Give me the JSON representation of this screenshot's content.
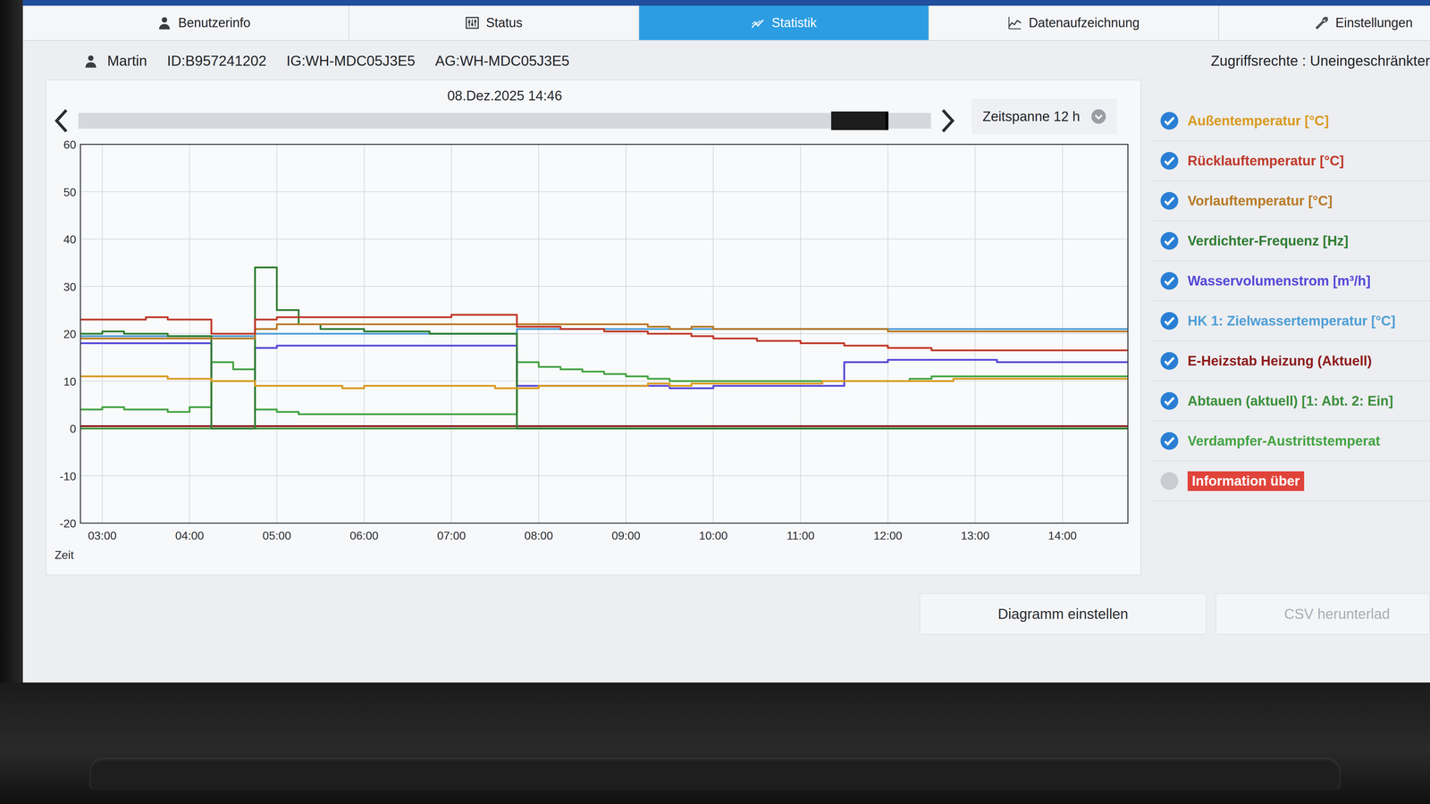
{
  "tabs": [
    {
      "label": "Benutzerinfo",
      "selected": false
    },
    {
      "label": "Status",
      "selected": false
    },
    {
      "label": "Statistik",
      "selected": true
    },
    {
      "label": "Datenaufzeichnung",
      "selected": false
    },
    {
      "label": "Einstellungen",
      "selected": false
    }
  ],
  "user": {
    "name": "Martin",
    "id": "ID:B957241202",
    "ig": "IG:WH-MDC05J3E5",
    "ag": "AG:WH-MDC05J3E5",
    "access": "Zugriffsrechte : Uneingeschränkter"
  },
  "chart": {
    "date": "08.Dez.2025 14:46",
    "timeline_level": 0.95,
    "span": "Zeitspanne 12 h",
    "x_label": "Zeit",
    "y_ticks": [
      "60",
      "50",
      "40",
      "30",
      "20",
      "10",
      "0",
      "-10",
      "-20"
    ],
    "x_ticks": [
      "03:00",
      "04:00",
      "05:00",
      "06:00",
      "07:00",
      "08:00",
      "09:00",
      "10:00",
      "11:00",
      "12:00",
      "13:00",
      "14:00"
    ],
    "y_min": -20,
    "y_max": 60,
    "x_min": 2.75,
    "x_max": 14.75,
    "x_start": 2.75,
    "x_step": 0.25,
    "series": [
      {
        "label": "Außentemperatur [°C]",
        "kind": "series",
        "checked": true,
        "color": "#d99a1e",
        "values": [
          11,
          11,
          11,
          11,
          10.5,
          10.5,
          10,
          10,
          9,
          9,
          9,
          9,
          8.5,
          9,
          9,
          9,
          9,
          9,
          9,
          8.5,
          8.5,
          9,
          9,
          9,
          9,
          9,
          9.5,
          9,
          9.5,
          9.5,
          9.5,
          9.5,
          9.5,
          9.5,
          10,
          10,
          10,
          10,
          10,
          10,
          10.5,
          10.5,
          10.5,
          10.5,
          10.5,
          10.5,
          10.5,
          10.5,
          10.5
        ]
      },
      {
        "label": "Rücklauftemperatur [°C]",
        "kind": "series",
        "checked": true,
        "color": "#c0392b",
        "values": [
          23,
          23,
          23,
          23.5,
          23,
          23,
          20,
          20,
          23,
          23.5,
          23.5,
          23.5,
          23.5,
          23.5,
          23.5,
          23.5,
          23.5,
          24,
          24,
          24,
          21.5,
          21.5,
          21,
          21,
          20.5,
          20.5,
          20,
          20,
          19.5,
          19,
          19,
          18.5,
          18.5,
          18,
          18,
          17.5,
          17.5,
          17,
          17,
          16.5,
          16.5,
          16.5,
          16.5,
          16.5,
          16.5,
          16.5,
          16.5,
          16.5,
          16.5
        ]
      },
      {
        "label": "Vorlauftemperatur [°C]",
        "kind": "series",
        "checked": true,
        "color": "#b87a26",
        "values": [
          19,
          19,
          19,
          19,
          19,
          19,
          19,
          19,
          21,
          22,
          22,
          22,
          22,
          22,
          22,
          22,
          22,
          22,
          22,
          22,
          22,
          22,
          22,
          22,
          22,
          22,
          21.5,
          21,
          21.5,
          21,
          21,
          21,
          21,
          21,
          21,
          21,
          21,
          20.5,
          20.5,
          20.5,
          20.5,
          20.5,
          20.5,
          20.5,
          20.5,
          20.5,
          20.5,
          20.5,
          20.5
        ]
      },
      {
        "label": "Verdichter-Frequenz [Hz]",
        "kind": "series",
        "checked": true,
        "color": "#2f7d32",
        "values": [
          20,
          20.5,
          20,
          20,
          19.5,
          19.5,
          0,
          0,
          34,
          25,
          22,
          21,
          21,
          20.5,
          20.5,
          20.5,
          20,
          20,
          20,
          20,
          0,
          0,
          0,
          0,
          0,
          0,
          0,
          0,
          0,
          0,
          0,
          0,
          0,
          0,
          0,
          0,
          0,
          0,
          0,
          0,
          0,
          0,
          0,
          0,
          0,
          0,
          0,
          0,
          0
        ]
      },
      {
        "label": "Wasservolumenstrom [m³/h]",
        "kind": "series",
        "checked": true,
        "color": "#5548d9",
        "values": [
          18,
          18,
          18,
          18,
          18,
          18,
          10,
          10,
          17,
          17.5,
          17.5,
          17.5,
          17.5,
          17.5,
          17.5,
          17.5,
          17.5,
          17.5,
          17.5,
          17.5,
          9,
          9,
          9,
          9,
          9,
          9,
          9,
          8.5,
          8.5,
          9,
          9,
          9,
          9,
          9,
          9,
          14,
          14,
          14.5,
          14.5,
          14.5,
          14.5,
          14.5,
          14,
          14,
          14,
          14,
          14,
          14,
          14
        ]
      },
      {
        "label": "HK 1: Zielwassertemperatur [°C]",
        "kind": "series",
        "checked": true,
        "color": "#4f9fd6",
        "values": [
          19.5,
          19.5,
          19.5,
          19.5,
          19.5,
          19.5,
          19.5,
          19.5,
          20,
          20,
          20,
          20,
          20,
          20,
          20,
          20,
          20,
          20,
          20,
          20,
          21,
          21,
          21,
          21,
          21,
          21,
          21,
          21,
          21,
          21,
          21,
          21,
          21,
          21,
          21,
          21,
          21,
          21,
          21,
          21,
          21,
          21,
          21,
          21,
          21,
          21,
          21,
          21,
          21
        ]
      },
      {
        "label": "E-Heizstab Heizung (Aktuell)",
        "kind": "series",
        "checked": true,
        "color": "#8e1c1c",
        "values": [
          0.5,
          0.5,
          0.5,
          0.5,
          0.5,
          0.5,
          0.5,
          0.5,
          0.5,
          0.5,
          0.5,
          0.5,
          0.5,
          0.5,
          0.5,
          0.5,
          0.5,
          0.5,
          0.5,
          0.5,
          0.5,
          0.5,
          0.5,
          0.5,
          0.5,
          0.5,
          0.5,
          0.5,
          0.5,
          0.5,
          0.5,
          0.5,
          0.5,
          0.5,
          0.5,
          0.5,
          0.5,
          0.5,
          0.5,
          0.5,
          0.5,
          0.5,
          0.5,
          0.5,
          0.5,
          0.5,
          0.5,
          0.5,
          0.5
        ]
      },
      {
        "label": "Abtauen (aktuell) [1: Abt. 2: Ein]",
        "kind": "series",
        "checked": true,
        "color": "#3b8f3b",
        "values": [
          0,
          0,
          0,
          0,
          0,
          0,
          0,
          0,
          0,
          0,
          0,
          0,
          0,
          0,
          0,
          0,
          0,
          0,
          0,
          0,
          0,
          0,
          0,
          0,
          0,
          0,
          0,
          0,
          0,
          0,
          0,
          0,
          0,
          0,
          0,
          0,
          0,
          0,
          0,
          0,
          0,
          0,
          0,
          0,
          0,
          0,
          0,
          0,
          0
        ]
      },
      {
        "label": "Verdampfer-Austrittstemperat",
        "kind": "series",
        "checked": true,
        "color": "#43a343",
        "values": [
          4,
          4.5,
          4,
          4,
          3.5,
          4.5,
          14,
          12.5,
          4,
          3.5,
          3,
          3,
          3,
          3,
          3,
          3,
          3,
          3,
          3,
          3,
          14,
          13,
          12.5,
          12,
          11.5,
          11,
          10.5,
          10,
          10,
          10,
          10,
          10,
          10,
          10,
          10,
          10,
          10,
          10,
          10.5,
          11,
          11,
          11,
          11,
          11,
          11,
          11,
          11,
          11,
          11
        ]
      },
      {
        "label": "Information über",
        "kind": "notice",
        "checked": false,
        "color": "#e0433a",
        "values": []
      }
    ]
  },
  "buttons": [
    {
      "label": "Diagramm einstellen",
      "disabled": false
    },
    {
      "label": "CSV herunterlad",
      "disabled": true
    }
  ]
}
